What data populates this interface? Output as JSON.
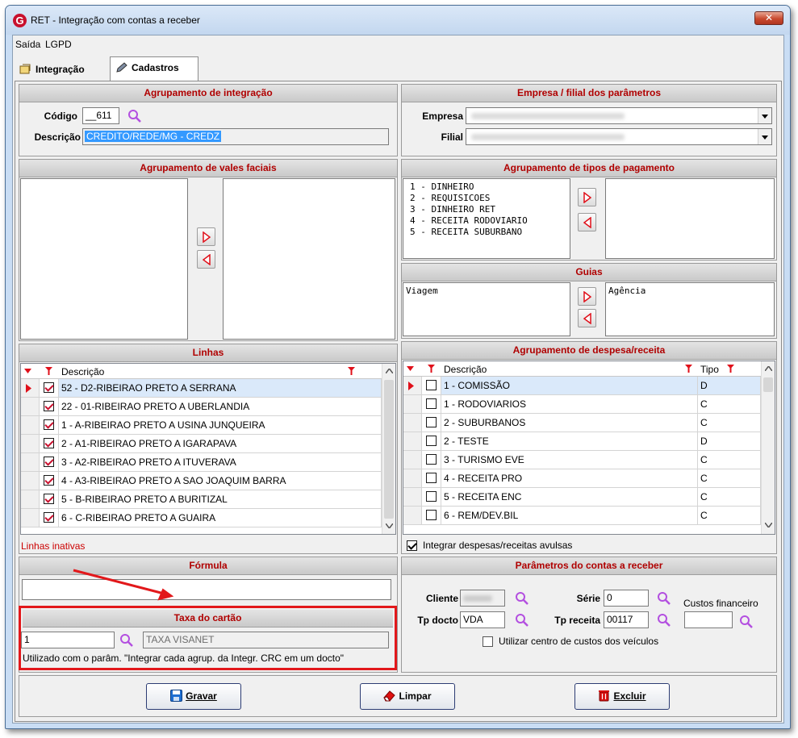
{
  "window": {
    "title": "RET - Integração com contas a receber",
    "close": "✕"
  },
  "menu": {
    "items": [
      "Saída",
      "LGPD"
    ]
  },
  "tabs": [
    {
      "label": "Integração"
    },
    {
      "label": "Cadastros"
    }
  ],
  "agrupamento_integracao": {
    "title": "Agrupamento de integração",
    "codigo_label": "Código",
    "codigo_value": "__611",
    "descricao_label": "Descrição",
    "descricao_value": "CREDITO/REDE/MG - CREDZ"
  },
  "empresa_filial": {
    "title": "Empresa / filial  dos parâmetros",
    "empresa_label": "Empresa",
    "filial_label": "Filial"
  },
  "vales_faciais": {
    "title": "Agrupamento de vales faciais"
  },
  "tipos_pagamento": {
    "title": "Agrupamento de tipos de pagamento",
    "items": [
      "1 - DINHEIRO",
      "2 - REQUISICOES",
      "3 - DINHEIRO RET",
      "4 - RECEITA RODOVIARIO",
      "5 - RECEITA SUBURBANO"
    ]
  },
  "guias": {
    "title": "Guias",
    "left": "Viagem",
    "right": "Agência"
  },
  "linhas": {
    "title": "Linhas",
    "column": "Descrição",
    "rows": [
      {
        "desc": "52 - D2-RIBEIRAO PRETO A SERRANA",
        "checked": true
      },
      {
        "desc": "22 - 01-RIBEIRAO PRETO A UBERLANDIA",
        "checked": true
      },
      {
        "desc": "1 - A-RIBEIRAO PRETO A USINA JUNQUEIRA",
        "checked": true
      },
      {
        "desc": "2 - A1-RIBEIRAO PRETO A IGARAPAVA",
        "checked": true
      },
      {
        "desc": "3 - A2-RIBEIRAO PRETO A ITUVERAVA",
        "checked": true
      },
      {
        "desc": "4 - A3-RIBEIRAO PRETO A SAO JOAQUIM BARRA",
        "checked": true
      },
      {
        "desc": "5 - B-RIBEIRAO PRETO A BURITIZAL",
        "checked": true
      },
      {
        "desc": "6 - C-RIBEIRAO PRETO A GUAIRA",
        "checked": true
      }
    ],
    "inactive_label": "Linhas inativas"
  },
  "despesa_receita": {
    "title": "Agrupamento de despesa/receita",
    "col_desc": "Descrição",
    "col_tipo": "Tipo",
    "rows": [
      {
        "desc": "1 - COMISSÃO",
        "tipo": "D"
      },
      {
        "desc": "1 - RODOVIARIOS",
        "tipo": "C"
      },
      {
        "desc": "2 - SUBURBANOS",
        "tipo": "C"
      },
      {
        "desc": "2 - TESTE",
        "tipo": "D"
      },
      {
        "desc": "3 - TURISMO EVE",
        "tipo": "C"
      },
      {
        "desc": "4 - RECEITA PRO",
        "tipo": "C"
      },
      {
        "desc": "5 - RECEITA ENC",
        "tipo": "C"
      },
      {
        "desc": "6 - REM/DEV.BIL",
        "tipo": "C"
      }
    ],
    "avulsas_label": "Integrar despesas/receitas avulsas",
    "avulsas_checked": true
  },
  "formula": {
    "title": "Fórmula",
    "value": ""
  },
  "taxa_cartao": {
    "title": "Taxa do cartão",
    "code": "1",
    "name": "TAXA VISANET",
    "note": "Utilizado com o parâm. \"Integrar cada agrup. da Integr. CRC em um docto\""
  },
  "contas_receber": {
    "title": "Parâmetros do contas a receber",
    "cliente_label": "Cliente",
    "serie_label": "Série",
    "serie_value": "0",
    "custos_label": "Custos financeiro",
    "tp_docto_label": "Tp docto",
    "tp_docto_value": "VDA",
    "tp_receita_label": "Tp receita",
    "tp_receita_value": "00117",
    "centro_custos_label": "Utilizar centro de custos dos veículos"
  },
  "buttons": {
    "gravar": "Gravar",
    "limpar": "Limpar",
    "excluir": "Excluir"
  },
  "colors": {
    "header_text": "#b00000",
    "highlight": "#e2181b",
    "selection": "#3399ff"
  }
}
